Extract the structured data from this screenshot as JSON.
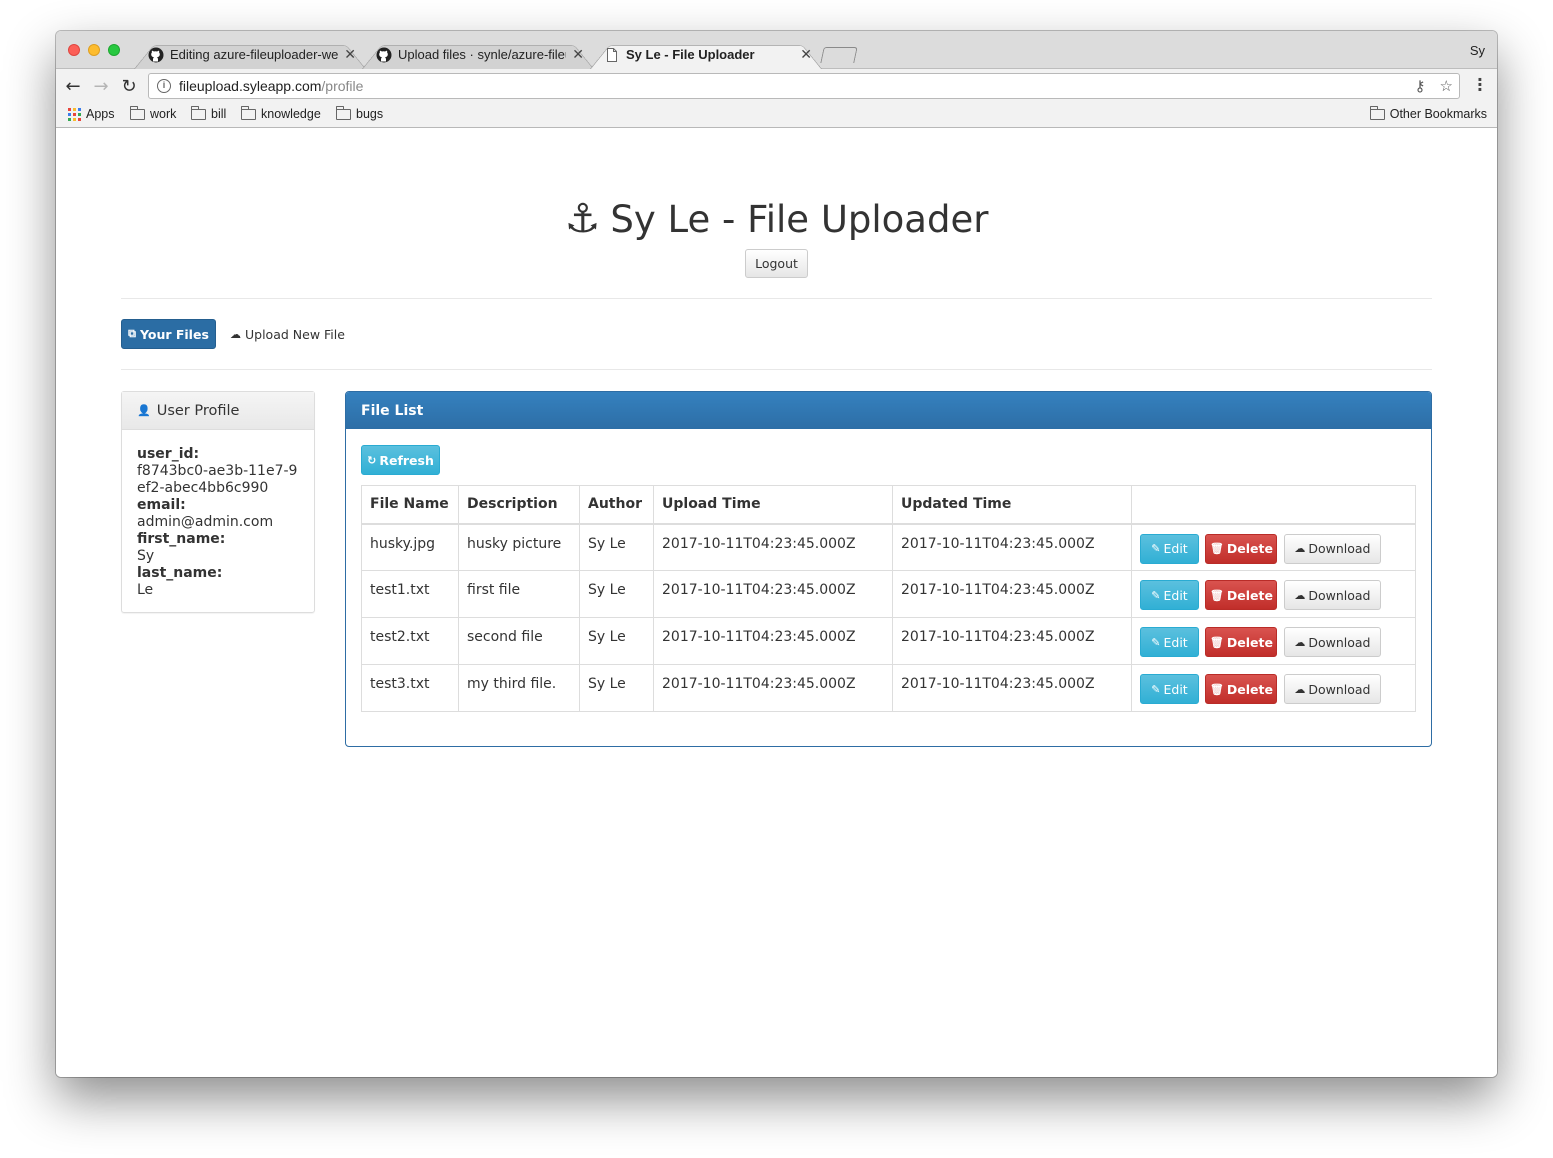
{
  "browser": {
    "tabs": [
      {
        "title": "Editing azure-fileuploader-web",
        "icon": "github-icon",
        "active": false
      },
      {
        "title": "Upload files · synle/azure-fileu",
        "icon": "github-icon",
        "active": false
      },
      {
        "title": "Sy Le - File Uploader",
        "icon": "page-icon",
        "active": true
      }
    ],
    "profile_name": "Sy",
    "url_host": "fileupload.syleapp.com",
    "url_path": "/profile",
    "bookmarks": [
      "Apps",
      "work",
      "bill",
      "knowledge",
      "bugs"
    ],
    "other_bookmarks": "Other Bookmarks"
  },
  "header": {
    "anchor_icon": "⚓",
    "title": "Sy Le - File Uploader",
    "logout_label": "Logout"
  },
  "nav": {
    "your_files_label": "Your Files",
    "upload_new_label": "Upload New File"
  },
  "profile": {
    "heading": "User Profile",
    "fields": [
      {
        "key": "user_id:",
        "value": "f8743bc0-ae3b-11e7-9ef2-abec4bb6c990"
      },
      {
        "key": "email:",
        "value": "admin@admin.com"
      },
      {
        "key": "first_name:",
        "value": "Sy"
      },
      {
        "key": "last_name:",
        "value": "Le"
      }
    ]
  },
  "file_list": {
    "heading": "File List",
    "refresh_label": "Refresh",
    "columns": [
      "File Name",
      "Description",
      "Author",
      "Upload Time",
      "Updated Time"
    ],
    "rows": [
      {
        "name": "husky.jpg",
        "description": "husky picture",
        "author": "Sy Le",
        "upload_time": "2017-10-11T04:23:45.000Z",
        "updated_time": "2017-10-11T04:23:45.000Z"
      },
      {
        "name": "test1.txt",
        "description": "first file",
        "author": "Sy Le",
        "upload_time": "2017-10-11T04:23:45.000Z",
        "updated_time": "2017-10-11T04:23:45.000Z"
      },
      {
        "name": "test2.txt",
        "description": "second file",
        "author": "Sy Le",
        "upload_time": "2017-10-11T04:23:45.000Z",
        "updated_time": "2017-10-11T04:23:45.000Z"
      },
      {
        "name": "test3.txt",
        "description": "my third file.",
        "author": "Sy Le",
        "upload_time": "2017-10-11T04:23:45.000Z",
        "updated_time": "2017-10-11T04:23:45.000Z"
      }
    ],
    "edit_label": "Edit",
    "delete_label": "Delete",
    "download_label": "Download"
  },
  "colors": {
    "primary": "#2b6da4",
    "info": "#31b0d5",
    "danger": "#d9534f"
  }
}
